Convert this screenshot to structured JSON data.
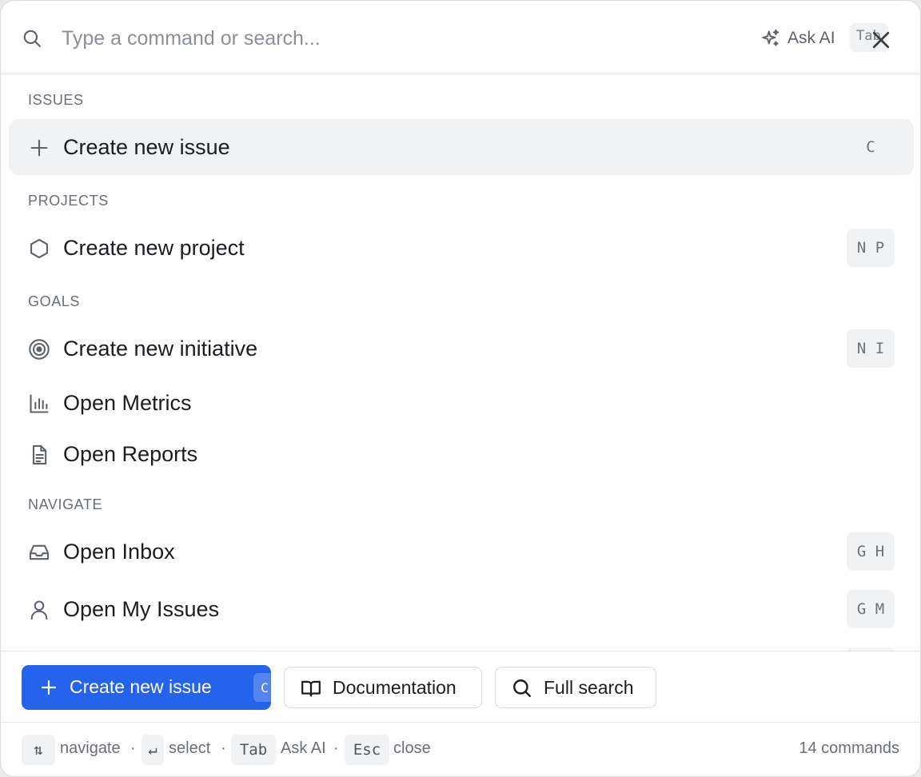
{
  "search": {
    "placeholder": "Type a command or search..."
  },
  "header": {
    "ask_ai_label": "Ask AI",
    "tab_key": "Tab"
  },
  "sections": {
    "issues": "ISSUES",
    "projects": "PROJECTS",
    "goals": "GOALS",
    "navigate": "NAVIGATE"
  },
  "items": {
    "create_issue": {
      "label": "Create new issue",
      "shortcut": "C",
      "icon": "plus-icon"
    },
    "create_project": {
      "label": "Create new project",
      "shortcut": "N P",
      "icon": "hexagon-icon"
    },
    "create_initiative": {
      "label": "Create new initiative",
      "shortcut": "N I",
      "icon": "target-icon"
    },
    "open_metrics": {
      "label": "Open Metrics",
      "icon": "bar-chart-icon"
    },
    "open_reports": {
      "label": "Open Reports",
      "icon": "document-icon"
    },
    "open_inbox": {
      "label": "Open Inbox",
      "shortcut": "G H",
      "icon": "inbox-icon"
    },
    "open_my_issues": {
      "label": "Open My Issues",
      "shortcut": "G M",
      "icon": "user-icon"
    }
  },
  "actions": {
    "primary": {
      "label": "Create new issue",
      "key": "C"
    },
    "documentation": "Documentation",
    "full_search": "Full search"
  },
  "footer": {
    "navigate_key": "⇅",
    "navigate_label": "navigate",
    "select_key": "↵",
    "select_label": "select",
    "ask_key": "Tab",
    "ask_label": "Ask AI",
    "close_key": "Esc",
    "close_label": "close",
    "separator": "·",
    "command_count": "14 commands"
  },
  "colors": {
    "accent": "#2463eb",
    "active_row": "#f1f2f4",
    "muted_text": "#6a6e76"
  }
}
